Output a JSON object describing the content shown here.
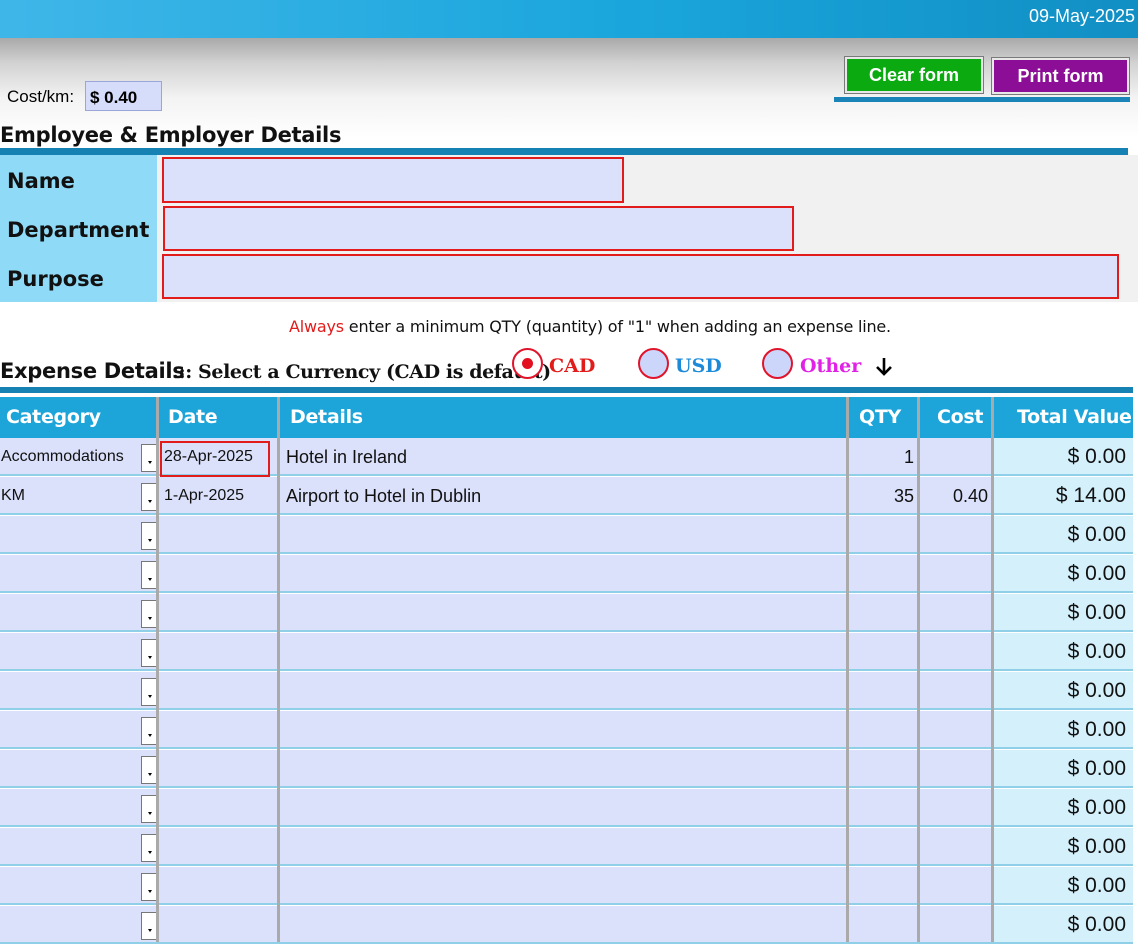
{
  "header": {
    "date": "09-May-2025"
  },
  "cost_per_km": {
    "label": "Cost/km:",
    "value": "$ 0.40"
  },
  "toolbar": {
    "clear_label": "Clear form",
    "print_label": "Print form"
  },
  "employee_section": {
    "title": "Employee & Employer Details",
    "fields": [
      {
        "label": "Name",
        "value": ""
      },
      {
        "label": "Department",
        "value": ""
      },
      {
        "label": "Purpose",
        "value": ""
      }
    ]
  },
  "notice": {
    "emphasis": "Always",
    "text": " enter a minimum QTY (quantity) of \"1\" when adding an expense line."
  },
  "expense_section": {
    "title": "Expense Details",
    "currency_prompt": "::: Select a Currency (CAD is default)",
    "currencies": [
      {
        "label": "CAD",
        "selected": true,
        "color": "#e21b1b"
      },
      {
        "label": "USD",
        "selected": false,
        "color": "#1c8ad8"
      },
      {
        "label": "Other",
        "selected": false,
        "color": "#e122e6"
      }
    ],
    "arrow_icon": "down-arrow-icon"
  },
  "table": {
    "columns": [
      "Category",
      "Date",
      "Details",
      "QTY",
      "Cost",
      "Total Value"
    ],
    "rows": [
      {
        "category": "Accommodations",
        "date": "28-Apr-2025",
        "details": "Hotel in Ireland",
        "qty": "1",
        "cost": "",
        "total": "$ 0.00"
      },
      {
        "category": "KM",
        "date": "1-Apr-2025",
        "details": "Airport to Hotel in Dublin",
        "qty": "35",
        "cost": "0.40",
        "total": "$ 14.00"
      },
      {
        "category": "",
        "date": "",
        "details": "",
        "qty": "",
        "cost": "",
        "total": "$ 0.00"
      },
      {
        "category": "",
        "date": "",
        "details": "",
        "qty": "",
        "cost": "",
        "total": "$ 0.00"
      },
      {
        "category": "",
        "date": "",
        "details": "",
        "qty": "",
        "cost": "",
        "total": "$ 0.00"
      },
      {
        "category": "",
        "date": "",
        "details": "",
        "qty": "",
        "cost": "",
        "total": "$ 0.00"
      },
      {
        "category": "",
        "date": "",
        "details": "",
        "qty": "",
        "cost": "",
        "total": "$ 0.00"
      },
      {
        "category": "",
        "date": "",
        "details": "",
        "qty": "",
        "cost": "",
        "total": "$ 0.00"
      },
      {
        "category": "",
        "date": "",
        "details": "",
        "qty": "",
        "cost": "",
        "total": "$ 0.00"
      },
      {
        "category": "",
        "date": "",
        "details": "",
        "qty": "",
        "cost": "",
        "total": "$ 0.00"
      },
      {
        "category": "",
        "date": "",
        "details": "",
        "qty": "",
        "cost": "",
        "total": "$ 0.00"
      },
      {
        "category": "",
        "date": "",
        "details": "",
        "qty": "",
        "cost": "",
        "total": "$ 0.00"
      },
      {
        "category": "",
        "date": "",
        "details": "",
        "qty": "",
        "cost": "",
        "total": "$ 0.00"
      }
    ]
  }
}
